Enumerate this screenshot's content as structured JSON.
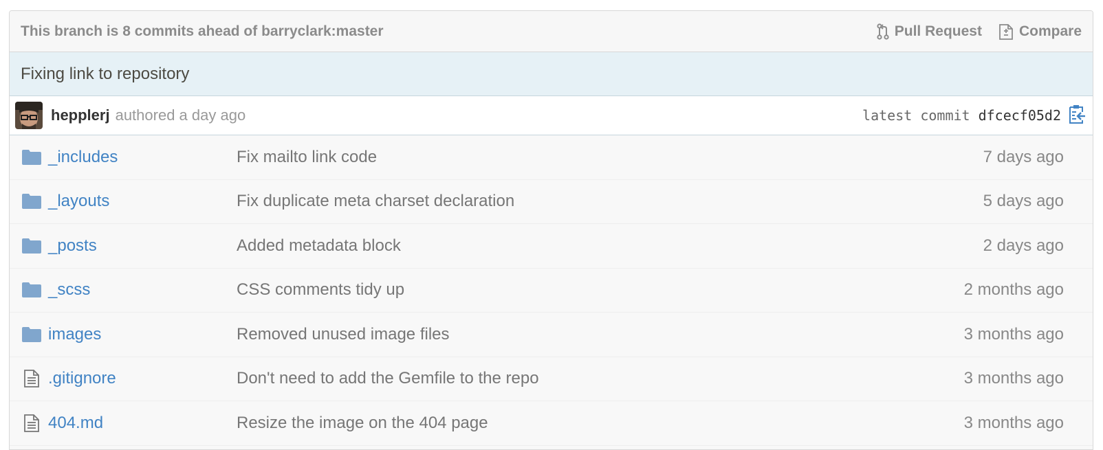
{
  "branch_bar": {
    "status": "This branch is 8 commits ahead of barryclark:master",
    "pull_request_label": "Pull Request",
    "compare_label": "Compare"
  },
  "commit": {
    "title": "Fixing link to repository",
    "author": "hepplerj",
    "authored_text": "authored a day ago",
    "latest_label": "latest commit",
    "sha": "dfcecf05d2"
  },
  "files": [
    {
      "type": "folder",
      "icon": "folder-icon",
      "name": "_includes",
      "message": "Fix mailto link code",
      "age": "7 days ago"
    },
    {
      "type": "folder",
      "icon": "folder-icon",
      "name": "_layouts",
      "message": "Fix duplicate meta charset declaration",
      "age": "5 days ago"
    },
    {
      "type": "folder",
      "icon": "folder-icon",
      "name": "_posts",
      "message": "Added metadata block",
      "age": "2 days ago"
    },
    {
      "type": "folder",
      "icon": "folder-icon",
      "name": "_scss",
      "message": "CSS comments tidy up",
      "age": "2 months ago"
    },
    {
      "type": "folder",
      "icon": "folder-icon",
      "name": "images",
      "message": "Removed unused image files",
      "age": "3 months ago"
    },
    {
      "type": "file",
      "icon": "file-text-icon",
      "name": ".gitignore",
      "message": "Don't need to add the Gemfile to the repo",
      "age": "3 months ago"
    },
    {
      "type": "file",
      "icon": "file-text-icon",
      "name": "404.md",
      "message": "Resize the image on the 404 page",
      "age": "3 months ago"
    }
  ],
  "colors": {
    "link": "#4183c4",
    "folder_icon": "#80a6cd",
    "commit_bar_bg": "#e6f1f6",
    "muted_text": "#8b8b8b"
  }
}
